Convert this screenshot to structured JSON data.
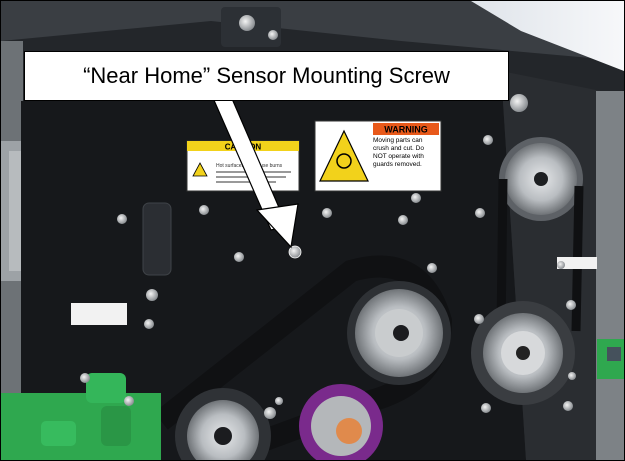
{
  "callout": {
    "text": "“Near Home” Sensor Mounting Screw"
  },
  "labels": {
    "caution": {
      "heading": "CAUTION",
      "body": "Hot surfaces can cause burns"
    },
    "warning": {
      "heading": "WARNING",
      "body": "Moving parts can crush and cut. Do NOT operate with guards removed."
    }
  },
  "colors": {
    "panel": "#16181b",
    "frame_gray": "#8c9196",
    "caution_yellow": "#f2d21b",
    "warning_orange": "#e8591a",
    "green_board": "#2fa84f",
    "purple_pulley": "#7a2a8c",
    "bronze_hub": "#e08a4c"
  }
}
